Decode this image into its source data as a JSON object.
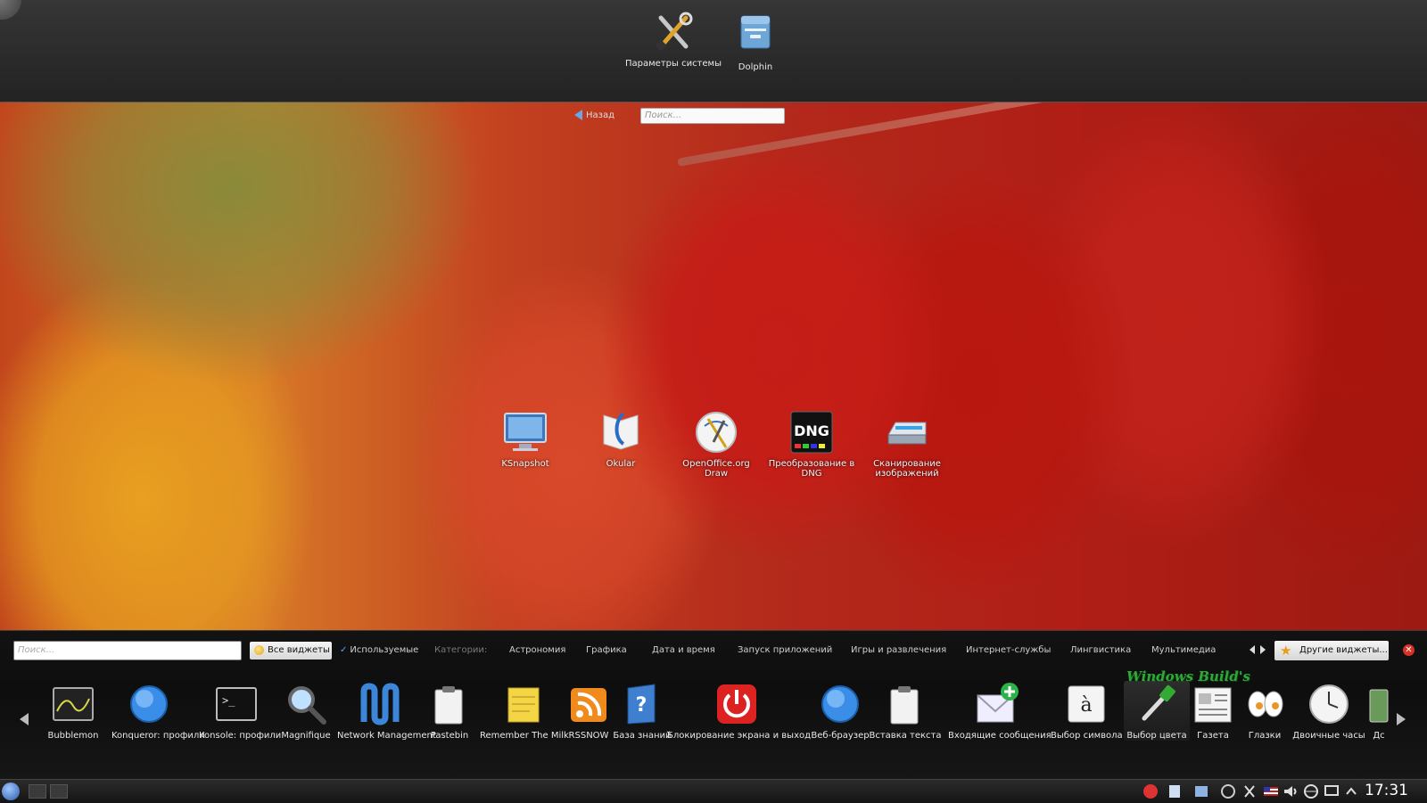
{
  "desktop": {
    "favorites": [
      {
        "label": "Параметры системы",
        "icon": "tools-icon"
      },
      {
        "label": "Dolphin",
        "icon": "file-manager-icon"
      }
    ],
    "back_label": "Назад",
    "search_placeholder": "Поиск...",
    "apps": [
      {
        "label": "KSnapshot",
        "icon": "monitor-snapshot-icon"
      },
      {
        "label": "Okular",
        "icon": "document-viewer-icon"
      },
      {
        "label": "OpenOffice.org Draw",
        "icon": "draw-icon"
      },
      {
        "label": "Преобразование в DNG",
        "icon": "dng-icon"
      },
      {
        "label": "Сканирование изображений",
        "icon": "scanner-icon"
      }
    ]
  },
  "widgets": {
    "search_placeholder": "Поиск...",
    "filters": {
      "all": "Все виджеты",
      "used": "Используемые",
      "categories_label": "Категории:",
      "categories": [
        "Астрономия",
        "Графика",
        "Дата и время",
        "Запуск приложений",
        "Игры и развлечения",
        "Интернет-службы",
        "Лингвистика",
        "Мультимедиа"
      ]
    },
    "other_button": "Другие виджеты...",
    "watermark": "Windows Build's",
    "items": [
      {
        "label": "Bubblemon",
        "icon": "bubblemon-icon"
      },
      {
        "label": "Konqueror: профили",
        "icon": "globe-icon"
      },
      {
        "label": "Konsole: профили",
        "icon": "terminal-icon"
      },
      {
        "label": "Magnifique",
        "icon": "magnifier-icon"
      },
      {
        "label": "Network Management",
        "icon": "network-icon"
      },
      {
        "label": "Pastebin",
        "icon": "paste-icon"
      },
      {
        "label": "Remember The Milk",
        "icon": "notepad-icon"
      },
      {
        "label": "RSSNOW",
        "icon": "rss-icon"
      },
      {
        "label": "База знаний",
        "icon": "help-icon"
      },
      {
        "label": "Блокирование экрана и выход",
        "icon": "power-icon"
      },
      {
        "label": "Веб-браузер",
        "icon": "globe-icon"
      },
      {
        "label": "Вставка текста",
        "icon": "paste-icon"
      },
      {
        "label": "Входящие сообщения",
        "icon": "mail-add-icon"
      },
      {
        "label": "Выбор символа",
        "icon": "character-icon"
      },
      {
        "label": "Выбор цвета",
        "icon": "color-picker-icon"
      },
      {
        "label": "Газета",
        "icon": "newspaper-icon"
      },
      {
        "label": "Глазки",
        "icon": "eyes-icon"
      },
      {
        "label": "Двоичные часы",
        "icon": "clock-icon"
      },
      {
        "label": "Дс",
        "icon": "widget-icon"
      }
    ]
  },
  "taskbar": {
    "clock": "17:31"
  },
  "colors": {
    "accent": "#4aa3ff",
    "close": "#d93025",
    "watermark": "#2fa83a"
  }
}
